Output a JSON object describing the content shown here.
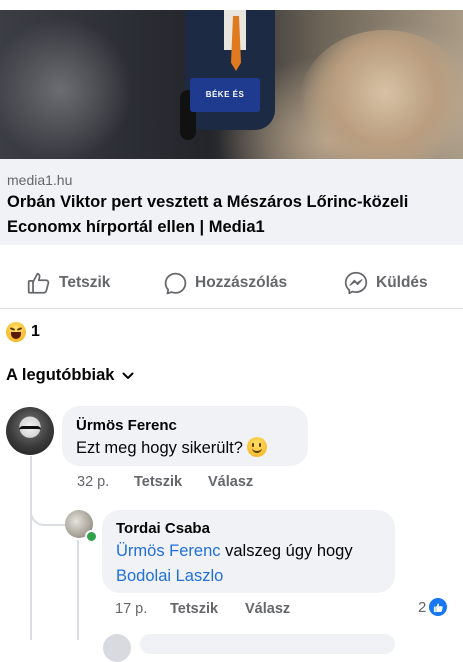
{
  "link_preview": {
    "podium_text": "BÉKE ÉS",
    "domain": "media1.hu",
    "title": "Orbán Viktor pert vesztett a Mészáros Lőrinc-közeli Economx hírportál ellen | Media1"
  },
  "actions": {
    "like_label": "Tetszik",
    "comment_label": "Hozzászólás",
    "send_label": "Küldés"
  },
  "reactions": {
    "icon": "haha-reaction-icon",
    "count": "1"
  },
  "sort": {
    "label": "A legutóbbiak"
  },
  "comments": [
    {
      "author": "Ürmös Ferenc",
      "text": "Ezt meg hogy sikerült?",
      "emoji": "slightly-smiling-face",
      "time": "32 p.",
      "like_label": "Tetszik",
      "reply_label": "Válasz"
    },
    {
      "author": "Tordai Csaba",
      "mention1": "Ürmös Ferenc",
      "text_middle": " valszeg úgy hogy ",
      "mention2": "Bodolai Laszlo",
      "time": "17 p.",
      "like_label": "Tetszik",
      "reply_label": "Válasz",
      "like_count": "2",
      "online": true
    }
  ],
  "colors": {
    "link_blue": "#216fdb",
    "like_badge": "#1877f2",
    "online_green": "#31a24c",
    "bubble_bg": "#f0f2f5",
    "secondary_text": "#65676b"
  }
}
